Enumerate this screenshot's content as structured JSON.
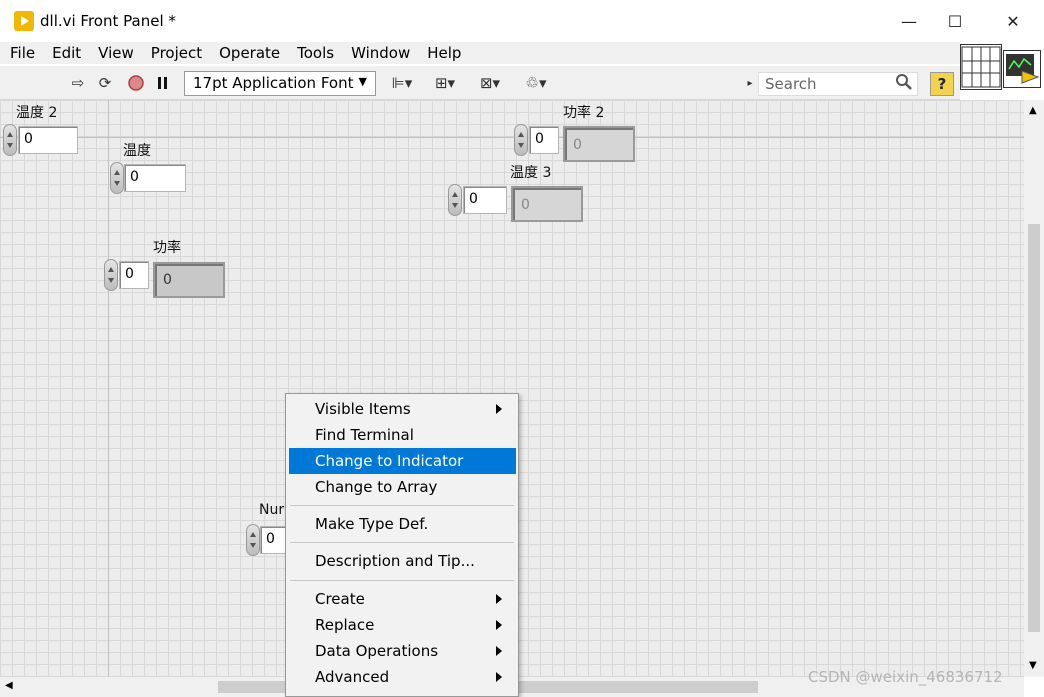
{
  "window": {
    "title": "dll.vi Front Panel *",
    "minimize": "—",
    "maximize": "☐",
    "close": "✕"
  },
  "menu": [
    "File",
    "Edit",
    "View",
    "Project",
    "Operate",
    "Tools",
    "Window",
    "Help"
  ],
  "toolbar": {
    "font": "17pt Application Font",
    "search_placeholder": "Search",
    "help": "?"
  },
  "controls": {
    "wendu2": {
      "label": "温度 2",
      "value": "0"
    },
    "wendu": {
      "label": "温度",
      "value": "0"
    },
    "gonglv": {
      "label": "功率",
      "control_value": "0",
      "indicator_value": "0"
    },
    "gonglv2": {
      "label": "功率 2",
      "control_value": "0",
      "indicator_value": "0"
    },
    "wendu3": {
      "label": "温度 3",
      "control_value": "0",
      "indicator_value": "0"
    },
    "numeric": {
      "label": "Nur",
      "value": "0"
    }
  },
  "context_menu": {
    "items": [
      "Visible Items",
      "Find Terminal",
      "Change to Indicator",
      "Change to Array",
      "Make Type Def.",
      "Description and Tip...",
      "Create",
      "Replace",
      "Data Operations",
      "Advanced"
    ],
    "highlighted": "Change to Indicator"
  },
  "watermark": "CSDN @weixin_46836712",
  "colors": {
    "highlight": "#0078d7",
    "panel": "#ececec"
  }
}
